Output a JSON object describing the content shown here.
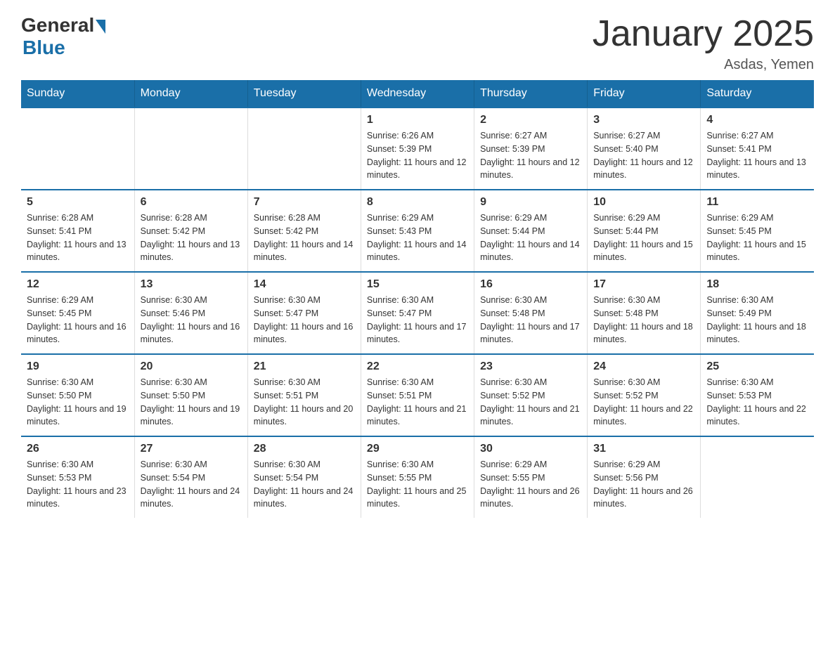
{
  "header": {
    "logo_general": "General",
    "logo_blue": "Blue",
    "title": "January 2025",
    "location": "Asdas, Yemen"
  },
  "days_of_week": [
    "Sunday",
    "Monday",
    "Tuesday",
    "Wednesday",
    "Thursday",
    "Friday",
    "Saturday"
  ],
  "weeks": [
    [
      {
        "day": "",
        "info": ""
      },
      {
        "day": "",
        "info": ""
      },
      {
        "day": "",
        "info": ""
      },
      {
        "day": "1",
        "info": "Sunrise: 6:26 AM\nSunset: 5:39 PM\nDaylight: 11 hours and 12 minutes."
      },
      {
        "day": "2",
        "info": "Sunrise: 6:27 AM\nSunset: 5:39 PM\nDaylight: 11 hours and 12 minutes."
      },
      {
        "day": "3",
        "info": "Sunrise: 6:27 AM\nSunset: 5:40 PM\nDaylight: 11 hours and 12 minutes."
      },
      {
        "day": "4",
        "info": "Sunrise: 6:27 AM\nSunset: 5:41 PM\nDaylight: 11 hours and 13 minutes."
      }
    ],
    [
      {
        "day": "5",
        "info": "Sunrise: 6:28 AM\nSunset: 5:41 PM\nDaylight: 11 hours and 13 minutes."
      },
      {
        "day": "6",
        "info": "Sunrise: 6:28 AM\nSunset: 5:42 PM\nDaylight: 11 hours and 13 minutes."
      },
      {
        "day": "7",
        "info": "Sunrise: 6:28 AM\nSunset: 5:42 PM\nDaylight: 11 hours and 14 minutes."
      },
      {
        "day": "8",
        "info": "Sunrise: 6:29 AM\nSunset: 5:43 PM\nDaylight: 11 hours and 14 minutes."
      },
      {
        "day": "9",
        "info": "Sunrise: 6:29 AM\nSunset: 5:44 PM\nDaylight: 11 hours and 14 minutes."
      },
      {
        "day": "10",
        "info": "Sunrise: 6:29 AM\nSunset: 5:44 PM\nDaylight: 11 hours and 15 minutes."
      },
      {
        "day": "11",
        "info": "Sunrise: 6:29 AM\nSunset: 5:45 PM\nDaylight: 11 hours and 15 minutes."
      }
    ],
    [
      {
        "day": "12",
        "info": "Sunrise: 6:29 AM\nSunset: 5:45 PM\nDaylight: 11 hours and 16 minutes."
      },
      {
        "day": "13",
        "info": "Sunrise: 6:30 AM\nSunset: 5:46 PM\nDaylight: 11 hours and 16 minutes."
      },
      {
        "day": "14",
        "info": "Sunrise: 6:30 AM\nSunset: 5:47 PM\nDaylight: 11 hours and 16 minutes."
      },
      {
        "day": "15",
        "info": "Sunrise: 6:30 AM\nSunset: 5:47 PM\nDaylight: 11 hours and 17 minutes."
      },
      {
        "day": "16",
        "info": "Sunrise: 6:30 AM\nSunset: 5:48 PM\nDaylight: 11 hours and 17 minutes."
      },
      {
        "day": "17",
        "info": "Sunrise: 6:30 AM\nSunset: 5:48 PM\nDaylight: 11 hours and 18 minutes."
      },
      {
        "day": "18",
        "info": "Sunrise: 6:30 AM\nSunset: 5:49 PM\nDaylight: 11 hours and 18 minutes."
      }
    ],
    [
      {
        "day": "19",
        "info": "Sunrise: 6:30 AM\nSunset: 5:50 PM\nDaylight: 11 hours and 19 minutes."
      },
      {
        "day": "20",
        "info": "Sunrise: 6:30 AM\nSunset: 5:50 PM\nDaylight: 11 hours and 19 minutes."
      },
      {
        "day": "21",
        "info": "Sunrise: 6:30 AM\nSunset: 5:51 PM\nDaylight: 11 hours and 20 minutes."
      },
      {
        "day": "22",
        "info": "Sunrise: 6:30 AM\nSunset: 5:51 PM\nDaylight: 11 hours and 21 minutes."
      },
      {
        "day": "23",
        "info": "Sunrise: 6:30 AM\nSunset: 5:52 PM\nDaylight: 11 hours and 21 minutes."
      },
      {
        "day": "24",
        "info": "Sunrise: 6:30 AM\nSunset: 5:52 PM\nDaylight: 11 hours and 22 minutes."
      },
      {
        "day": "25",
        "info": "Sunrise: 6:30 AM\nSunset: 5:53 PM\nDaylight: 11 hours and 22 minutes."
      }
    ],
    [
      {
        "day": "26",
        "info": "Sunrise: 6:30 AM\nSunset: 5:53 PM\nDaylight: 11 hours and 23 minutes."
      },
      {
        "day": "27",
        "info": "Sunrise: 6:30 AM\nSunset: 5:54 PM\nDaylight: 11 hours and 24 minutes."
      },
      {
        "day": "28",
        "info": "Sunrise: 6:30 AM\nSunset: 5:54 PM\nDaylight: 11 hours and 24 minutes."
      },
      {
        "day": "29",
        "info": "Sunrise: 6:30 AM\nSunset: 5:55 PM\nDaylight: 11 hours and 25 minutes."
      },
      {
        "day": "30",
        "info": "Sunrise: 6:29 AM\nSunset: 5:55 PM\nDaylight: 11 hours and 26 minutes."
      },
      {
        "day": "31",
        "info": "Sunrise: 6:29 AM\nSunset: 5:56 PM\nDaylight: 11 hours and 26 minutes."
      },
      {
        "day": "",
        "info": ""
      }
    ]
  ]
}
